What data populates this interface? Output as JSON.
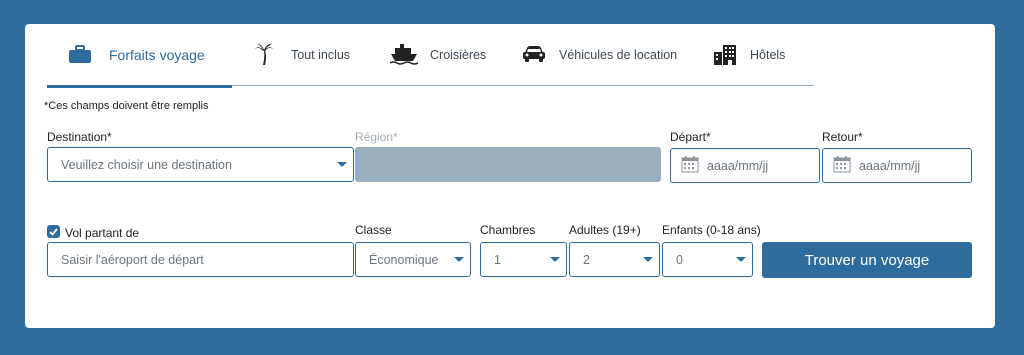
{
  "tabs": [
    {
      "label": "Forfaits voyage",
      "icon": "suitcase-icon",
      "active": true
    },
    {
      "label": "Tout inclus",
      "icon": "palm-tree-icon"
    },
    {
      "label": "Croisières",
      "icon": "ship-icon"
    },
    {
      "label": "Véhicules de location",
      "icon": "car-icon"
    },
    {
      "label": "Hôtels",
      "icon": "hotel-icon"
    }
  ],
  "required_note": "*Ces champs doivent être remplis",
  "destination": {
    "label": "Destination*",
    "placeholder": "Veuillez choisir une destination"
  },
  "region": {
    "label": "Région*"
  },
  "depart": {
    "label": "Départ*",
    "placeholder": "aaaa/mm/jj"
  },
  "retour": {
    "label": "Retour*",
    "placeholder": "aaaa/mm/jj"
  },
  "flight": {
    "label": "Vol partant de",
    "checked": true,
    "placeholder": "Saisir l'aéroport de départ"
  },
  "classe": {
    "label": "Classe",
    "value": "Économique"
  },
  "chambres": {
    "label": "Chambres",
    "value": "1"
  },
  "adultes": {
    "label": "Adultes (19+)",
    "value": "2"
  },
  "enfants": {
    "label": "Enfants (0-18 ans)",
    "value": "0"
  },
  "search_button": "Trouver un voyage",
  "colors": {
    "brand": "#2f6c9e",
    "disabled": "#9aaebd"
  }
}
